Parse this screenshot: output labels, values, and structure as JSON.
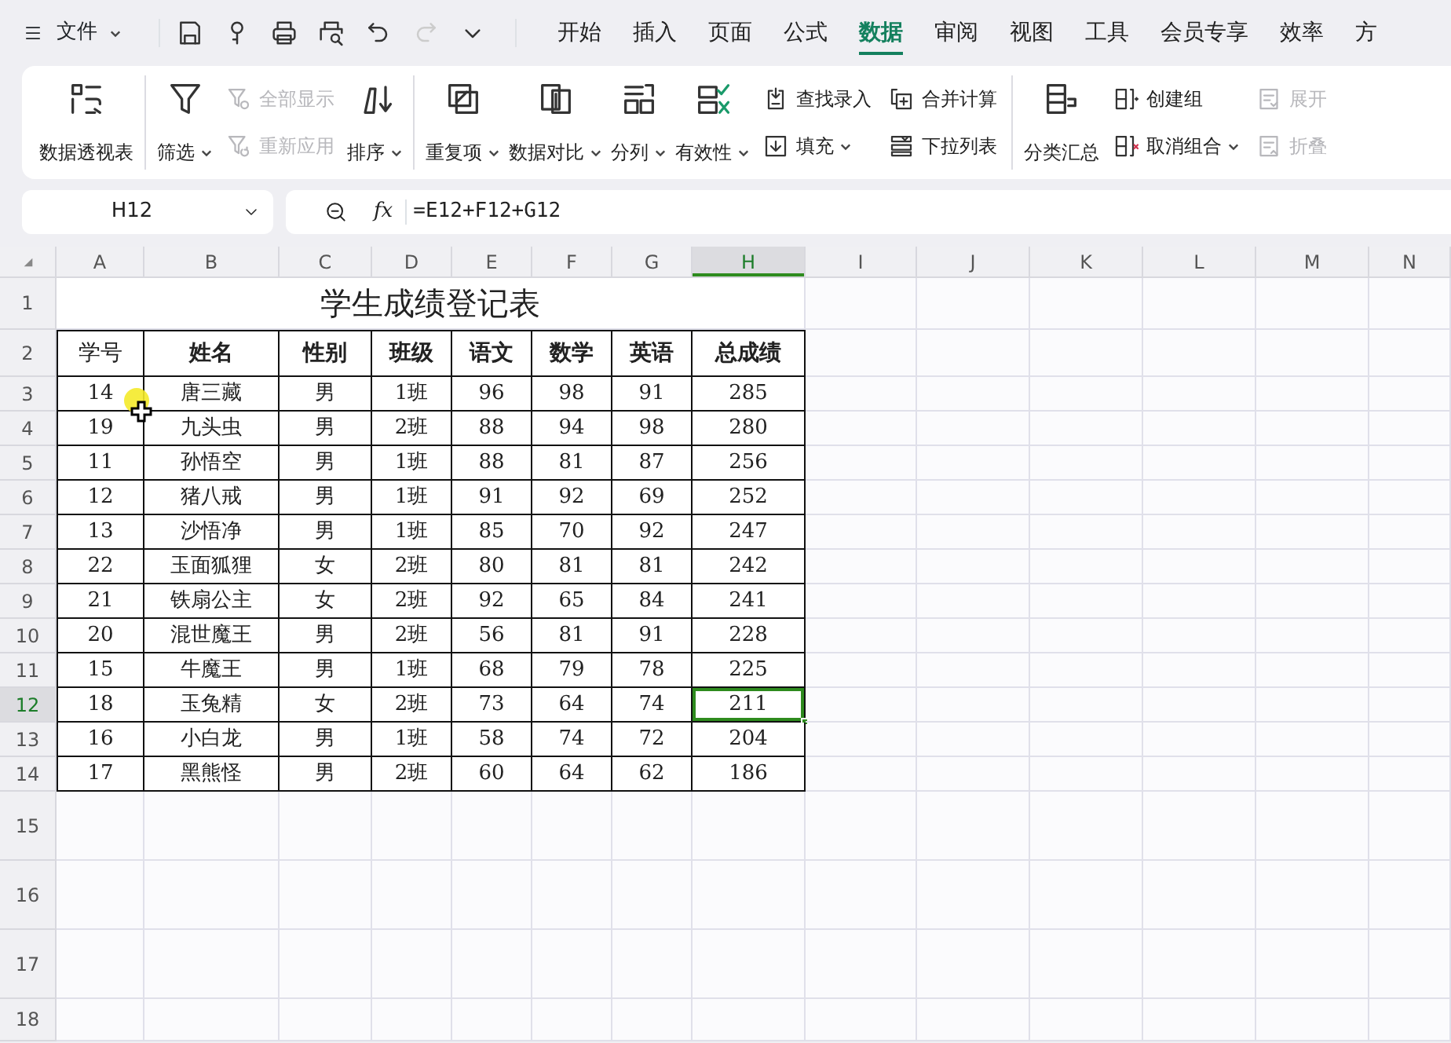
{
  "menu": {
    "label": "文件"
  },
  "quick_access": [
    {
      "disabled": false
    },
    {
      "disabled": false
    },
    {
      "disabled": false
    },
    {
      "disabled": false
    },
    {
      "disabled": false
    },
    {
      "disabled": true
    },
    {
      "disabled": false
    }
  ],
  "tabs": [
    {
      "label": "开始",
      "selected": false
    },
    {
      "label": "插入",
      "selected": false
    },
    {
      "label": "页面",
      "selected": false
    },
    {
      "label": "公式",
      "selected": false
    },
    {
      "label": "数据",
      "selected": true
    },
    {
      "label": "审阅",
      "selected": false
    },
    {
      "label": "视图",
      "selected": false
    },
    {
      "label": "工具",
      "selected": false
    },
    {
      "label": "会员专享",
      "selected": false
    },
    {
      "label": "效率",
      "selected": false
    },
    {
      "label": "方",
      "selected": false
    }
  ],
  "ribbon": {
    "groups": [
      {
        "items": [
          {
            "label": "数据透视表",
            "kind": "large",
            "dropdown": false,
            "disabled": false
          }
        ]
      },
      {
        "items": [
          {
            "label": "筛选",
            "kind": "large",
            "dropdown": true,
            "disabled": false
          },
          {
            "label": "全部显示",
            "kind": "small",
            "dropdown": false,
            "disabled": true
          },
          {
            "label": "重新应用",
            "kind": "small",
            "dropdown": false,
            "disabled": true
          },
          {
            "label": "排序",
            "kind": "large",
            "dropdown": true,
            "disabled": false
          }
        ]
      },
      {
        "items": [
          {
            "label": "重复项",
            "kind": "large",
            "dropdown": true,
            "disabled": false
          },
          {
            "label": "数据对比",
            "kind": "large",
            "dropdown": true,
            "disabled": false
          },
          {
            "label": "分列",
            "kind": "large",
            "dropdown": true,
            "disabled": false
          },
          {
            "label": "有效性",
            "kind": "large",
            "dropdown": true,
            "disabled": false
          },
          {
            "label": "查找录入",
            "kind": "small",
            "dropdown": false,
            "disabled": false
          },
          {
            "label": "填充",
            "kind": "small",
            "dropdown": true,
            "disabled": false
          },
          {
            "label": "合并计算",
            "kind": "small",
            "dropdown": false,
            "disabled": false
          },
          {
            "label": "下拉列表",
            "kind": "small",
            "dropdown": false,
            "disabled": false
          }
        ]
      },
      {
        "items": [
          {
            "label": "分类汇总",
            "kind": "large",
            "dropdown": false,
            "disabled": false
          },
          {
            "label": "创建组",
            "kind": "small",
            "dropdown": false,
            "disabled": false
          },
          {
            "label": "取消组合",
            "kind": "small",
            "dropdown": true,
            "disabled": false
          },
          {
            "label": "展开",
            "kind": "small",
            "dropdown": false,
            "disabled": true
          },
          {
            "label": "折叠",
            "kind": "small",
            "dropdown": false,
            "disabled": true
          }
        ]
      }
    ]
  },
  "formula_bar": {
    "cell_ref": "H12",
    "fx": "fx",
    "formula": "=E12+F12+G12"
  },
  "sheet": {
    "columns": [
      {
        "label": "A",
        "selected": false
      },
      {
        "label": "B",
        "selected": false
      },
      {
        "label": "C",
        "selected": false
      },
      {
        "label": "D",
        "selected": false
      },
      {
        "label": "E",
        "selected": false
      },
      {
        "label": "F",
        "selected": false
      },
      {
        "label": "G",
        "selected": false
      },
      {
        "label": "H",
        "selected": true
      },
      {
        "label": "I",
        "selected": false
      },
      {
        "label": "J",
        "selected": false
      },
      {
        "label": "K",
        "selected": false
      },
      {
        "label": "L",
        "selected": false
      },
      {
        "label": "M",
        "selected": false
      },
      {
        "label": "N",
        "selected": false
      }
    ],
    "rows": [
      {
        "label": "1",
        "selected": false
      },
      {
        "label": "2",
        "selected": false
      },
      {
        "label": "3",
        "selected": false
      },
      {
        "label": "4",
        "selected": false
      },
      {
        "label": "5",
        "selected": false
      },
      {
        "label": "6",
        "selected": false
      },
      {
        "label": "7",
        "selected": false
      },
      {
        "label": "8",
        "selected": false
      },
      {
        "label": "9",
        "selected": false
      },
      {
        "label": "10",
        "selected": false
      },
      {
        "label": "11",
        "selected": false
      },
      {
        "label": "12",
        "selected": true
      },
      {
        "label": "13",
        "selected": false
      },
      {
        "label": "14",
        "selected": false
      },
      {
        "label": "15",
        "selected": false
      },
      {
        "label": "16",
        "selected": false
      },
      {
        "label": "17",
        "selected": false
      },
      {
        "label": "18",
        "selected": false
      }
    ],
    "title": "学生成绩登记表",
    "headers": [
      {
        "text": "学号",
        "bold": false
      },
      {
        "text": "姓名",
        "bold": true
      },
      {
        "text": "性别",
        "bold": true
      },
      {
        "text": "班级",
        "bold": true
      },
      {
        "text": "语文",
        "bold": true
      },
      {
        "text": "数学",
        "bold": true
      },
      {
        "text": "英语",
        "bold": true
      },
      {
        "text": "总成绩",
        "bold": true
      }
    ],
    "records": [
      [
        "14",
        "唐三藏",
        "男",
        "1班",
        "96",
        "98",
        "91",
        "285"
      ],
      [
        "19",
        "九头虫",
        "男",
        "2班",
        "88",
        "94",
        "98",
        "280"
      ],
      [
        "11",
        "孙悟空",
        "男",
        "1班",
        "88",
        "81",
        "87",
        "256"
      ],
      [
        "12",
        "猪八戒",
        "男",
        "1班",
        "91",
        "92",
        "69",
        "252"
      ],
      [
        "13",
        "沙悟净",
        "男",
        "1班",
        "85",
        "70",
        "92",
        "247"
      ],
      [
        "22",
        "玉面狐狸",
        "女",
        "2班",
        "80",
        "81",
        "81",
        "242"
      ],
      [
        "21",
        "铁扇公主",
        "女",
        "2班",
        "92",
        "65",
        "84",
        "241"
      ],
      [
        "20",
        "混世魔王",
        "男",
        "2班",
        "56",
        "81",
        "91",
        "228"
      ],
      [
        "15",
        "牛魔王",
        "男",
        "1班",
        "68",
        "79",
        "78",
        "225"
      ],
      [
        "18",
        "玉兔精",
        "女",
        "2班",
        "73",
        "64",
        "74",
        "211"
      ],
      [
        "16",
        "小白龙",
        "男",
        "1班",
        "58",
        "74",
        "72",
        "204"
      ],
      [
        "17",
        "黑熊怪",
        "男",
        "2班",
        "60",
        "64",
        "62",
        "186"
      ]
    ]
  }
}
